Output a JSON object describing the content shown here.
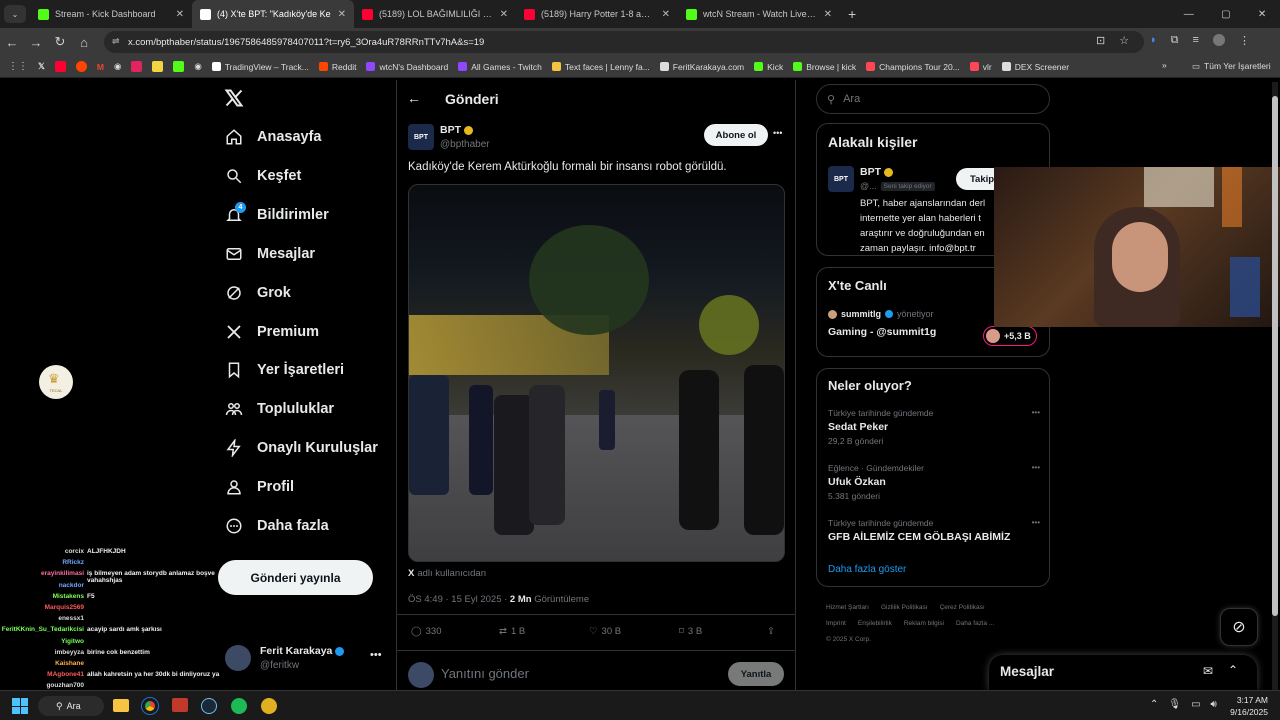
{
  "browser": {
    "tabs": [
      {
        "title": "Stream - Kick Dashboard",
        "color": "#53fc18",
        "active": false
      },
      {
        "title": "(4) X'te BPT: \"Kadıköy'de Ke",
        "color": "#ffffff",
        "active": true
      },
      {
        "title": "(5189) LOL BAĞIMLILIĞI 1.5 - Yo",
        "color": "#ff0033",
        "active": false
      },
      {
        "title": "(5189) Harry Potter 1-8 ama Tw",
        "color": "#ff0033",
        "active": false
      },
      {
        "title": "wtcN Stream - Watch Live on Ki",
        "color": "#53fc18",
        "active": false
      }
    ],
    "url": "x.com/bpthaber/status/1967586485978407011?t=ry6_3Ora4uR78RRnTTv7hA&s=19",
    "bookmarks": [
      {
        "label": "TradingView – Track...",
        "color": "#ffffff"
      },
      {
        "label": "Reddit",
        "color": "#ff4500"
      },
      {
        "label": "wtcN's Dashboard",
        "color": "#9146ff"
      },
      {
        "label": "All Games - Twitch",
        "color": "#9146ff"
      },
      {
        "label": "Text faces | Lenny fa...",
        "color": "#f5c542"
      },
      {
        "label": "FeritKarakaya.com",
        "color": "#dddddd"
      },
      {
        "label": "Kick",
        "color": "#53fc18"
      },
      {
        "label": "Browse | kick",
        "color": "#53fc18"
      },
      {
        "label": "Champions Tour 20...",
        "color": "#ff4655"
      },
      {
        "label": "vlr",
        "color": "#ff4655"
      },
      {
        "label": "DEX Screener",
        "color": "#dddddd"
      }
    ],
    "all_bookmarks": "Tüm Yer İşaretleri"
  },
  "sidebar": {
    "logo": "X",
    "items": [
      {
        "label": "Anasayfa",
        "icon": "home-icon"
      },
      {
        "label": "Keşfet",
        "icon": "search-icon"
      },
      {
        "label": "Bildirimler",
        "icon": "bell-icon",
        "badge": "4"
      },
      {
        "label": "Mesajlar",
        "icon": "mail-icon"
      },
      {
        "label": "Grok",
        "icon": "grok-icon"
      },
      {
        "label": "Premium",
        "icon": "x-icon"
      },
      {
        "label": "Yer İşaretleri",
        "icon": "bookmark-icon"
      },
      {
        "label": "Topluluklar",
        "icon": "people-icon"
      },
      {
        "label": "Onaylı Kuruluşlar",
        "icon": "lightning-icon"
      },
      {
        "label": "Profil",
        "icon": "person-icon"
      },
      {
        "label": "Daha fazla",
        "icon": "more-circle-icon"
      }
    ],
    "post_button": "Gönderi yayınla",
    "account": {
      "name": "Ferit Karakaya",
      "handle": "@feritkw"
    }
  },
  "post": {
    "header": "Gönderi",
    "author": {
      "name": "BPT",
      "handle": "@bpthaber",
      "avatar_text": "BPT"
    },
    "subscribe": "Abone ol",
    "text": "Kadıköy'de Kerem Aktürkoğlu formalı bir insansı robot görüldü.",
    "source_prefix": "X",
    "source_text": "adlı kullanıcıdan",
    "time": "ÖS 4:49 · 15 Eyl 2025 · ",
    "views_count": "2 Mn",
    "views_label": "Görüntüleme",
    "stats": {
      "replies": "330",
      "reposts": "1 B",
      "likes": "30 B",
      "bookmarks": "3 B"
    },
    "reply_placeholder": "Yanıtını gönder",
    "reply_button": "Yanıtla"
  },
  "right": {
    "search_placeholder": "Ara",
    "relevant": {
      "title": "Alakalı kişiler",
      "name": "BPT",
      "handle": "@...",
      "follows_you": "Seni takip ediyor",
      "follow": "Takip",
      "bio": "BPT, haber ajanslarından derl internette yer alan haberleri t araştırır ve doğruluğundan en zaman paylaşır. info@bpt.tr"
    },
    "live": {
      "title": "X'te Canlı",
      "host": "summitlg",
      "host_role": "yönetiyor",
      "stream": "Gaming - @summit1g",
      "viewers": "+5,3 B"
    },
    "trends": {
      "title": "Neler oluyor?",
      "items": [
        {
          "context": "Türkiye tarihinde gündemde",
          "name": "Sedat Peker",
          "count": "29,2 B gönderi"
        },
        {
          "context": "Eğlence · Gündemdekiler",
          "name": "Ufuk Özkan",
          "count": "5.381 gönderi"
        },
        {
          "context": "Türkiye tarihinde gündemde",
          "name": "GFB AİLEMİZ CEM GÖLBAŞI ABİMİZ",
          "count": ""
        }
      ],
      "show_more": "Daha fazla göster"
    },
    "footer": [
      "Hizmet Şartları",
      "Gizlilik Politikası",
      "Çerez Politikası",
      "Imprint",
      "Erişilebilirlik",
      "Reklam bilgisi",
      "Daha fazla ...",
      "© 2025 X Corp."
    ],
    "messages": "Mesajlar"
  },
  "overlay": {
    "badge_text": "TECAL"
  },
  "chat": [
    {
      "user": "corcix",
      "msg": "ALJFHKJDH",
      "color": "#dddddd"
    },
    {
      "user": "RRickz",
      "msg": "",
      "color": "#6fa8ff"
    },
    {
      "user": "erayinkilimasi",
      "msg": "iş bilmeyen adam storydb anlamaz boşve vahahshjas",
      "color": "#ff6f9f"
    },
    {
      "user": "nackdor",
      "msg": "",
      "color": "#6fa8ff"
    },
    {
      "user": "Mistakens",
      "msg": "F5",
      "color": "#7cff5a"
    },
    {
      "user": "Marquis2569",
      "msg": "",
      "color": "#ff5a5a"
    },
    {
      "user": "enessx1",
      "msg": "",
      "color": "#dddddd"
    },
    {
      "user": "FeritKKnin_Su_Tedarikcisi",
      "msg": "acayip sardı amk şarkısı",
      "color": "#7cff5a"
    },
    {
      "user": "Yigitwo",
      "msg": "",
      "color": "#7cff5a"
    },
    {
      "user": "imbeyyza",
      "msg": "birine cok benzettim",
      "color": "#dddddd"
    },
    {
      "user": "Kaishane",
      "msg": "",
      "color": "#ffb347"
    },
    {
      "user": "MAgbone41",
      "msg": "allah kahretsin ya her 30dk bi dinliyoruz ya",
      "color": "#ff5a5a"
    },
    {
      "user": "gouzhan700",
      "msg": "",
      "color": "#dddddd"
    }
  ],
  "taskbar": {
    "search": "Ara",
    "time": "3:17 AM",
    "date": "9/16/2025"
  }
}
